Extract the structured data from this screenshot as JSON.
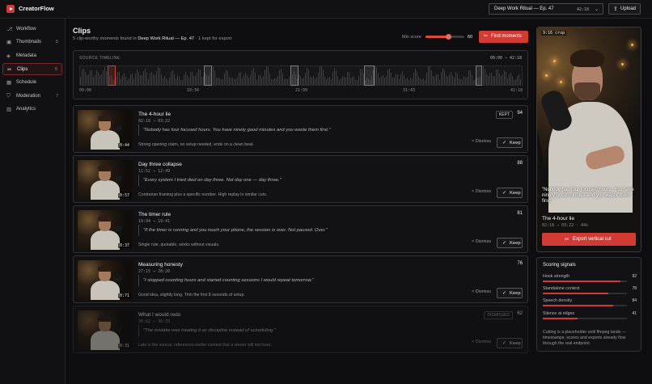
{
  "app": {
    "title": "CreatorFlow"
  },
  "header": {
    "episode_select": {
      "label": "Deep Work Ritual — Ep. 47",
      "duration": "42:18"
    },
    "upload_label": "Upload"
  },
  "sidebar": {
    "items": [
      {
        "label": "Workflow",
        "icon": "workflow-icon",
        "count": ""
      },
      {
        "label": "Thumbnails",
        "icon": "image-icon",
        "count": "5"
      },
      {
        "label": "Metadata",
        "icon": "tag-icon",
        "count": ""
      },
      {
        "label": "Clips",
        "icon": "scissors-icon",
        "count": "5",
        "active": true
      },
      {
        "label": "Schedule",
        "icon": "calendar-icon",
        "count": ""
      },
      {
        "label": "Moderation",
        "icon": "shield-icon",
        "count": "7"
      },
      {
        "label": "Analytics",
        "icon": "chart-icon",
        "count": ""
      }
    ]
  },
  "main": {
    "title": "Clips",
    "subtitle_pre": "5 clip-worthy moments found in",
    "subtitle_episode": "Deep Work Ritual — Ep. 47",
    "subtitle_post": "· 1 kept for export",
    "min_score_label": "Min score",
    "min_score_value": "60",
    "min_score_fraction": 0.6,
    "find_button": "Find moments"
  },
  "timeline": {
    "label": "SOURCE TIMELINE",
    "range": "00:00 — 42:18",
    "ticks": [
      "00:00",
      "10:34",
      "21:09",
      "31:43",
      "42:18"
    ]
  },
  "clips": [
    {
      "title": "The 4-hour lie",
      "time": "02:18 → 03:22",
      "duration": "0:44",
      "quote": "\"Nobody has four focused hours. You have ninety good minutes and you waste them first.\"",
      "note": "Strong opening claim, no setup needed, ends on a clean beat.",
      "badge": "KEPT",
      "score": "94",
      "state": "kept"
    },
    {
      "title": "Day three collapse",
      "time": "11:52 → 12:49",
      "duration": "0:57",
      "quote": "\"Every system I tried died on day three. Not day one — day three.\"",
      "note": "Contrarian framing plus a specific number. High replay in similar cuts.",
      "badge": "",
      "score": "88",
      "state": "normal"
    },
    {
      "title": "The timer rule",
      "time": "19:04 → 19:41",
      "duration": "0:37",
      "quote": "\"If the timer is running and you touch your phone, the session is over. Not paused. Over.\"",
      "note": "Single rule, quotable, works without visuals.",
      "badge": "",
      "score": "81",
      "state": "normal"
    },
    {
      "title": "Measuring honesty",
      "time": "27:15 → 28:26",
      "duration": "0:71",
      "quote": "\"I stopped counting hours and started counting sessions I would repeat tomorrow.\"",
      "note": "Good idea, slightly long. Trim the first 8 seconds of setup.",
      "badge": "",
      "score": "76",
      "state": "normal"
    },
    {
      "title": "What I would redo",
      "time": "36:02 → 36:33",
      "duration": "0:31",
      "quote": "\"The mistake was treating it as discipline instead of scheduling.\"",
      "note": "Late in the source, references earlier context that a viewer will not have.",
      "badge": "DISMISSED",
      "score": "62",
      "state": "dismissed"
    }
  ],
  "clip_actions": {
    "dismiss": "Dismiss",
    "keep": "Keep"
  },
  "preview": {
    "crop_label": "9:16 crop",
    "caption": "\"Nobody has four focused hours. You have ninety good minutes and you waste them first.\"",
    "title": "The 4-hour lie",
    "time": "02:18 → 03:22 · 44s",
    "export_button": "Export vertical cut"
  },
  "signals": {
    "title": "Scoring signals",
    "items": [
      {
        "label": "Hook strength",
        "value": "92"
      },
      {
        "label": "Standalone context",
        "value": "78"
      },
      {
        "label": "Speech density",
        "value": "84"
      },
      {
        "label": "Silence at edges",
        "value": "41"
      }
    ],
    "note": "Cutting is a placeholder until ffmpeg lands — timestamps, scores and exports already flow through the real endpoint."
  },
  "colors": {
    "accent": "#d23b33",
    "background": "#0e0e10"
  }
}
